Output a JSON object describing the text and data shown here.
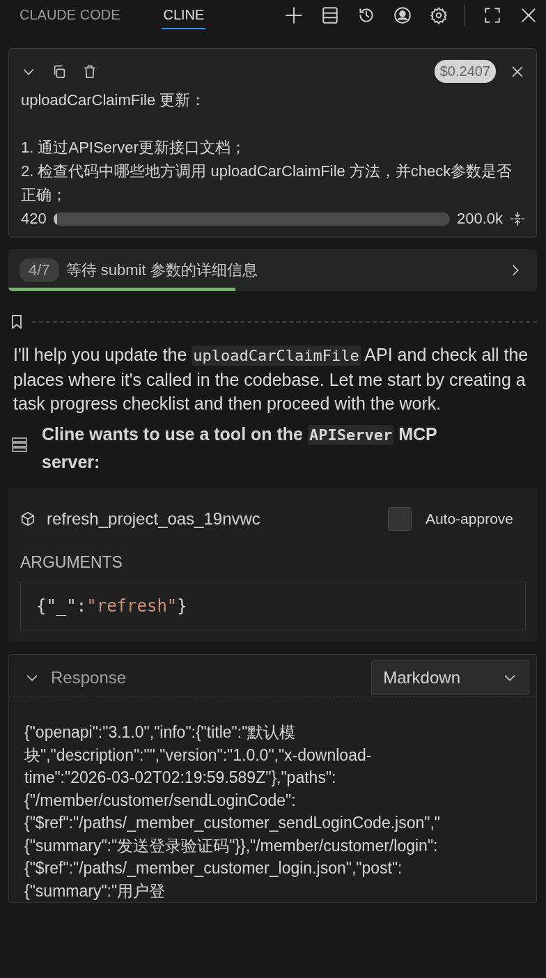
{
  "tabs": [
    {
      "label": "CLAUDE CODE",
      "selected": false
    },
    {
      "label": "CLINE",
      "selected": true
    }
  ],
  "task": {
    "cost": "$0.2407",
    "title": "uploadCarClaimFile 更新：",
    "steps": [
      "1. 通过APIServer更新接口文档；",
      "2. 检查代码中哪些地方调用 uploadCarClaimFile 方法，并check参数是否正确；"
    ]
  },
  "context": {
    "used": "420",
    "max": "200.0k",
    "level": 0.01
  },
  "progress": {
    "count": "4/7",
    "text": "等待 submit 参数的详细信息",
    "level": 0.43
  },
  "message": [
    {
      "kind": "text",
      "text": "I'll help you update the "
    },
    {
      "kind": "code",
      "text": "uploadCarClaimFile"
    },
    {
      "kind": "text",
      "text": " API and check all the places where it's called in the codebase. Let me start by creating a task progress checklist and then proceed with the work."
    }
  ],
  "tool_request": [
    {
      "kind": "text",
      "text": "Cline wants to use a tool on the "
    },
    {
      "kind": "code",
      "text": "APIServer"
    },
    {
      "kind": "text",
      "text": " MCP server:"
    }
  ],
  "tool": {
    "name": "refresh_project_oas_19nvwc",
    "auto_approve": {
      "label": "Auto-approve",
      "checked": false
    },
    "arguments_label": "ARGUMENTS",
    "arguments": [
      {
        "kind": "punct",
        "text": "{\"_\":"
      },
      {
        "kind": "string",
        "text": "\"refresh\""
      },
      {
        "kind": "punct",
        "text": "}"
      }
    ]
  },
  "response": {
    "label": "Response",
    "expanded": true,
    "format": "Markdown",
    "lines": [
      "{\"openapi\":\"3.1.0\",\"info\":{\"title\":\"默认模",
      "块\",\"description\":\"\",\"version\":\"1.0.0\",\"x-download-",
      "time\":\"2026-03-02T02:19:59.589Z\"},\"paths\":",
      "{\"/member/customer/sendLoginCode\":",
      "{\"$ref\":\"/paths/_member_customer_sendLoginCode.json\",\"",
      "{\"summary\":\"发送登录验证码\"}},\"/member/customer/login\":",
      "{\"$ref\":\"/paths/_member_customer_login.json\",\"post\":",
      "{\"summary\":\"用户登"
    ]
  }
}
